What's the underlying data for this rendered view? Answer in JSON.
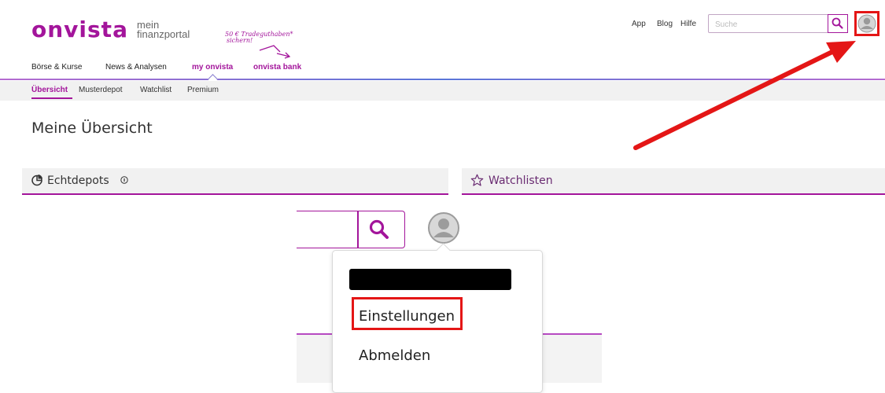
{
  "header": {
    "logo": "onvista",
    "tagline_line1": "mein",
    "tagline_line2": "finanzportal",
    "promo_line1": "50 € Tradeguthaben*",
    "promo_line2": "sichern!",
    "links": [
      "App",
      "Blog",
      "Hilfe"
    ],
    "search_placeholder": "Suche"
  },
  "main_nav": [
    "Börse & Kurse",
    "News & Analysen",
    "my onvista",
    "onvista bank"
  ],
  "sub_nav": [
    "Übersicht",
    "Musterdepot",
    "Watchlist",
    "Premium"
  ],
  "page_title": "Meine Übersicht",
  "sections": {
    "left_title": "Echtdepots",
    "right_title": "Watchlisten"
  },
  "dropdown": {
    "settings": "Einstellungen",
    "logout": "Abmelden"
  },
  "colors": {
    "brand": "#a3159b",
    "annotation": "#e41616"
  }
}
